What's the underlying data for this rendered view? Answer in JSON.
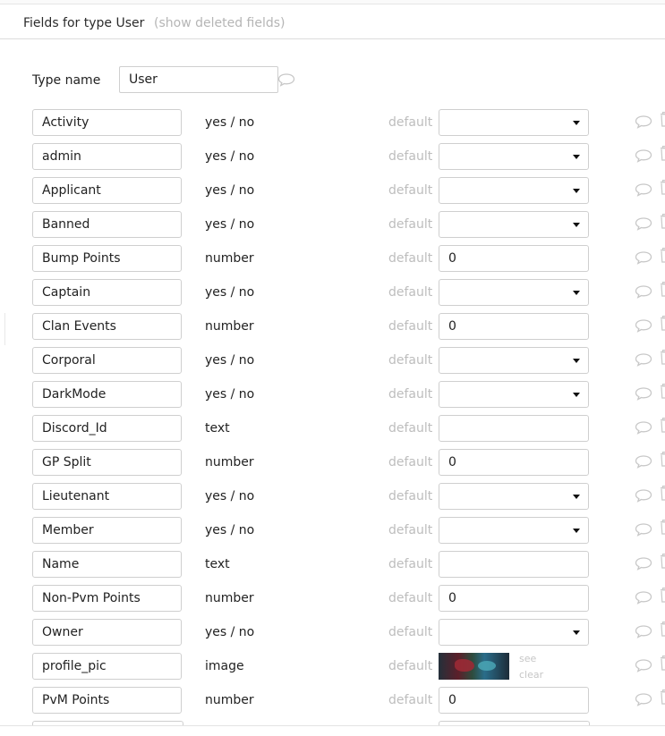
{
  "header": {
    "title": "Fields for type User",
    "deleted_link": "(show deleted fields)"
  },
  "type_name": {
    "label": "Type name",
    "value": "User"
  },
  "default_label": "default",
  "image_actions": {
    "see": "see",
    "clear": "clear"
  },
  "fields": [
    {
      "name": "Activity",
      "type": "yes / no",
      "control": "select",
      "default": ""
    },
    {
      "name": "admin",
      "type": "yes / no",
      "control": "select",
      "default": ""
    },
    {
      "name": "Applicant",
      "type": "yes / no",
      "control": "select",
      "default": ""
    },
    {
      "name": "Banned",
      "type": "yes / no",
      "control": "select",
      "default": ""
    },
    {
      "name": "Bump Points",
      "type": "number",
      "control": "input",
      "default": "0"
    },
    {
      "name": "Captain",
      "type": "yes / no",
      "control": "select",
      "default": ""
    },
    {
      "name": "Clan Events",
      "type": "number",
      "control": "input",
      "default": "0"
    },
    {
      "name": "Corporal",
      "type": "yes / no",
      "control": "select",
      "default": ""
    },
    {
      "name": "DarkMode",
      "type": "yes / no",
      "control": "select",
      "default": ""
    },
    {
      "name": "Discord_Id",
      "type": "text",
      "control": "input",
      "default": ""
    },
    {
      "name": "GP Split",
      "type": "number",
      "control": "input",
      "default": "0"
    },
    {
      "name": "Lieutenant",
      "type": "yes / no",
      "control": "select",
      "default": ""
    },
    {
      "name": "Member",
      "type": "yes / no",
      "control": "select",
      "default": ""
    },
    {
      "name": "Name",
      "type": "text",
      "control": "input",
      "default": ""
    },
    {
      "name": "Non-Pvm Points",
      "type": "number",
      "control": "input",
      "default": "0"
    },
    {
      "name": "Owner",
      "type": "yes / no",
      "control": "select",
      "default": ""
    },
    {
      "name": "profile_pic",
      "type": "image",
      "control": "image",
      "default": ""
    },
    {
      "name": "PvM Points",
      "type": "number",
      "control": "input",
      "default": "0"
    }
  ]
}
